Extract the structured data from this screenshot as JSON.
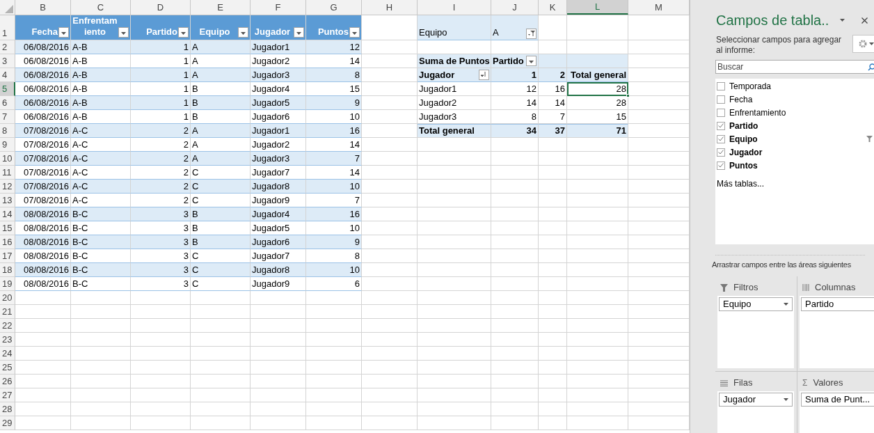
{
  "column_headers": [
    "B",
    "C",
    "D",
    "E",
    "F",
    "G",
    "H",
    "I",
    "J",
    "K",
    "L",
    "M"
  ],
  "row_numbers": [
    "1",
    "2",
    "3",
    "4",
    "5",
    "6",
    "7",
    "8",
    "9",
    "10",
    "11",
    "12",
    "13",
    "14",
    "15",
    "16",
    "17",
    "18",
    "19",
    "20",
    "21",
    "22",
    "23",
    "24",
    "25",
    "26",
    "27",
    "28",
    "29"
  ],
  "table": {
    "columns": [
      {
        "label": "Fecha",
        "kind": "date"
      },
      {
        "label": "Enfrentamiento",
        "kind": "text"
      },
      {
        "label": "Partido",
        "kind": "number"
      },
      {
        "label": "Equipo",
        "kind": "text"
      },
      {
        "label": "Jugador",
        "kind": "text"
      },
      {
        "label": "Puntos",
        "kind": "number"
      }
    ],
    "rows": [
      [
        "06/08/2016",
        "A-B",
        "1",
        "A",
        "Jugador1",
        "12"
      ],
      [
        "06/08/2016",
        "A-B",
        "1",
        "A",
        "Jugador2",
        "14"
      ],
      [
        "06/08/2016",
        "A-B",
        "1",
        "A",
        "Jugador3",
        "8"
      ],
      [
        "06/08/2016",
        "A-B",
        "1",
        "B",
        "Jugador4",
        "15"
      ],
      [
        "06/08/2016",
        "A-B",
        "1",
        "B",
        "Jugador5",
        "9"
      ],
      [
        "06/08/2016",
        "A-B",
        "1",
        "B",
        "Jugador6",
        "10"
      ],
      [
        "07/08/2016",
        "A-C",
        "2",
        "A",
        "Jugador1",
        "16"
      ],
      [
        "07/08/2016",
        "A-C",
        "2",
        "A",
        "Jugador2",
        "14"
      ],
      [
        "07/08/2016",
        "A-C",
        "2",
        "A",
        "Jugador3",
        "7"
      ],
      [
        "07/08/2016",
        "A-C",
        "2",
        "C",
        "Jugador7",
        "14"
      ],
      [
        "07/08/2016",
        "A-C",
        "2",
        "C",
        "Jugador8",
        "10"
      ],
      [
        "07/08/2016",
        "A-C",
        "2",
        "C",
        "Jugador9",
        "7"
      ],
      [
        "08/08/2016",
        "B-C",
        "3",
        "B",
        "Jugador4",
        "16"
      ],
      [
        "08/08/2016",
        "B-C",
        "3",
        "B",
        "Jugador5",
        "10"
      ],
      [
        "08/08/2016",
        "B-C",
        "3",
        "B",
        "Jugador6",
        "9"
      ],
      [
        "08/08/2016",
        "B-C",
        "3",
        "C",
        "Jugador7",
        "8"
      ],
      [
        "08/08/2016",
        "B-C",
        "3",
        "C",
        "Jugador8",
        "10"
      ],
      [
        "08/08/2016",
        "B-C",
        "3",
        "C",
        "Jugador9",
        "6"
      ]
    ]
  },
  "pivot": {
    "filter": {
      "field": "Equipo",
      "value": "A",
      "filtered": true
    },
    "header": {
      "value_label": "Suma de Puntos",
      "column_field": "Partido"
    },
    "columns": [
      "Jugador",
      "1",
      "2",
      "Total general"
    ],
    "rows": [
      {
        "cells": [
          "Jugador1",
          "12",
          "16",
          "28"
        ],
        "selected": true
      },
      {
        "cells": [
          "Jugador2",
          "14",
          "14",
          "28"
        ],
        "selected": false
      },
      {
        "cells": [
          "Jugador3",
          "8",
          "7",
          "15"
        ],
        "selected": false
      }
    ],
    "total": [
      "Total general",
      "34",
      "37",
      "71"
    ]
  },
  "panel": {
    "title": "Campos de tabla..",
    "subtitle": "Seleccionar campos para agregar al informe:",
    "search": {
      "placeholder": "Buscar"
    },
    "fields": [
      {
        "label": "Temporada",
        "checked": false,
        "filtered": false
      },
      {
        "label": "Fecha",
        "checked": false,
        "filtered": false
      },
      {
        "label": "Enfrentamiento",
        "checked": false,
        "filtered": false
      },
      {
        "label": "Partido",
        "checked": true,
        "filtered": false
      },
      {
        "label": "Equipo",
        "checked": true,
        "filtered": true
      },
      {
        "label": "Jugador",
        "checked": true,
        "filtered": false
      },
      {
        "label": "Puntos",
        "checked": true,
        "filtered": false
      }
    ],
    "more_tables": "Más tablas...",
    "areas_hint": "Arrastrar campos entre las áreas siguientes",
    "areas": [
      {
        "kind": "filters",
        "title": "Filtros",
        "items": [
          "Equipo"
        ]
      },
      {
        "kind": "columns",
        "title": "Columnas",
        "items": [
          "Partido"
        ]
      },
      {
        "kind": "rows",
        "title": "Filas",
        "items": [
          "Jugador"
        ]
      },
      {
        "kind": "values",
        "title": "Valores",
        "symbol": "Σ",
        "items": [
          "Suma de Punt..."
        ]
      }
    ]
  }
}
